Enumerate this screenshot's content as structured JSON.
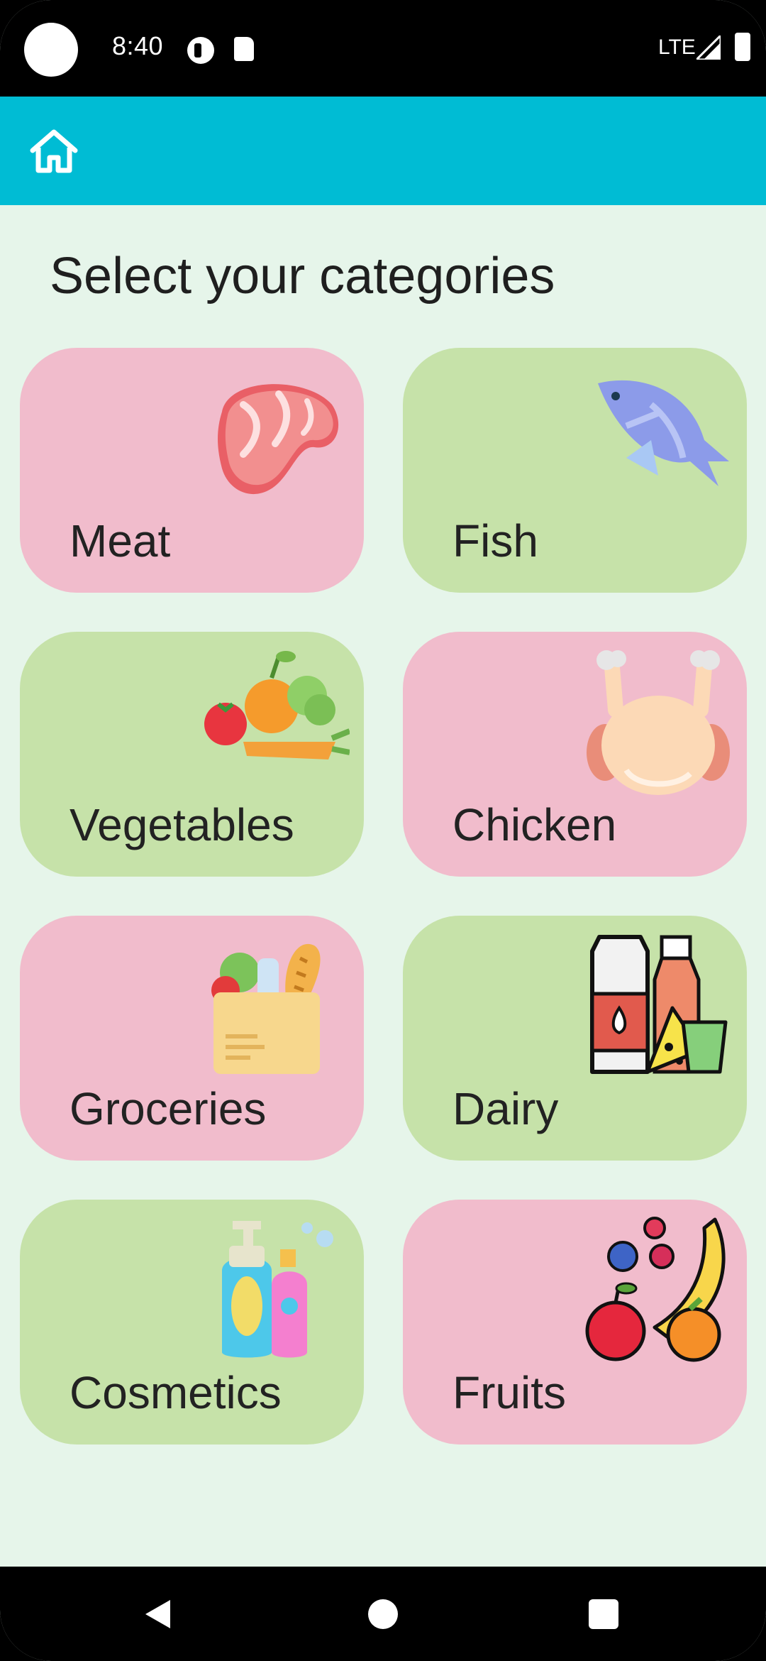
{
  "status_bar": {
    "time": "8:40",
    "network": "LTE",
    "icons": [
      "camera-cutout",
      "data-saver-icon",
      "sd-card-icon",
      "signal-icon",
      "battery-icon"
    ]
  },
  "app_bar": {
    "home_icon": "home-icon",
    "color": "#00bcd4"
  },
  "page": {
    "title": "Select your categories"
  },
  "categories": [
    {
      "label": "Meat",
      "icon": "meat-icon",
      "color": "#f1bccc"
    },
    {
      "label": "Fish",
      "icon": "fish-icon",
      "color": "#c6e2a9"
    },
    {
      "label": "Vegetables",
      "icon": "vegetables-icon",
      "color": "#c6e2a9"
    },
    {
      "label": "Chicken",
      "icon": "chicken-icon",
      "color": "#f1bccc"
    },
    {
      "label": "Groceries",
      "icon": "groceries-icon",
      "color": "#f1bccc"
    },
    {
      "label": "Dairy",
      "icon": "dairy-icon",
      "color": "#c6e2a9"
    },
    {
      "label": "Cosmetics",
      "icon": "cosmetics-icon",
      "color": "#c6e2a9"
    },
    {
      "label": "Fruits",
      "icon": "fruits-icon",
      "color": "#f1bccc"
    }
  ],
  "nav_bar": {
    "buttons": [
      "back-icon",
      "home-circle-icon",
      "recents-icon"
    ]
  },
  "theme": {
    "background": "#e6f5ea",
    "pink_card": "#f1bccc",
    "green_card": "#c6e2a9"
  }
}
